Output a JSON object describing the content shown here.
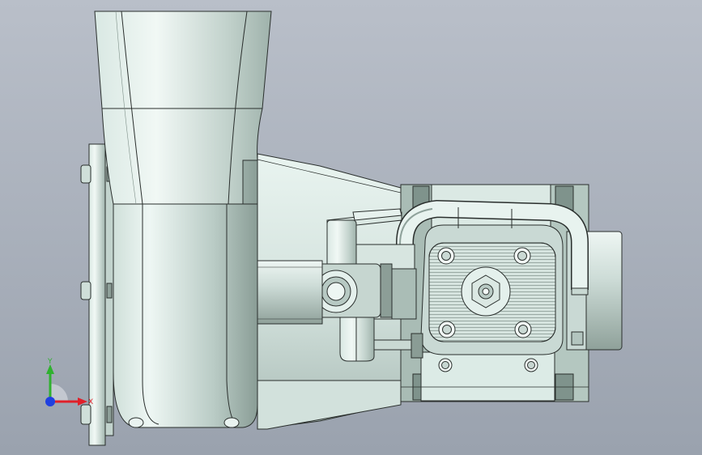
{
  "triad": {
    "x_label": "X",
    "y_label": "Y",
    "x_color": "#e0202a",
    "y_color": "#2fb12f",
    "z_color": "#2040e0"
  },
  "colors": {
    "viewport_top": "#b9bfc9",
    "viewport_bottom": "#9aa2ae",
    "part_light": "#e6f2ee",
    "part_mid": "#c3d3cd",
    "part_dark": "#7e9089",
    "edge": "#2a2f2d"
  }
}
